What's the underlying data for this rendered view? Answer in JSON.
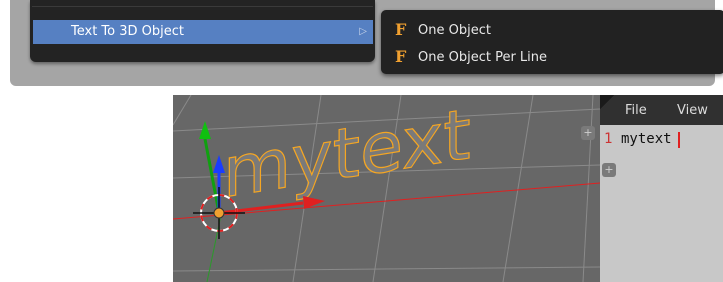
{
  "menu": {
    "text3d_label": "Text To 3D Object",
    "submenu_items": [
      {
        "label": "One Object",
        "icon": "font-f-icon"
      },
      {
        "label": "One Object Per Line",
        "icon": "font-f-icon"
      }
    ]
  },
  "viewport": {
    "object_text": "mytext"
  },
  "editor": {
    "menu_file": "File",
    "menu_view": "View",
    "line_number": "1",
    "line_text": "mytext"
  },
  "colors": {
    "menu_highlight": "#5680c2",
    "font_icon": "#f0a030",
    "selection_outline": "#f5a623",
    "x_axis": "#e02020",
    "y_axis": "#10a010",
    "z_axis": "#1a3cff"
  }
}
